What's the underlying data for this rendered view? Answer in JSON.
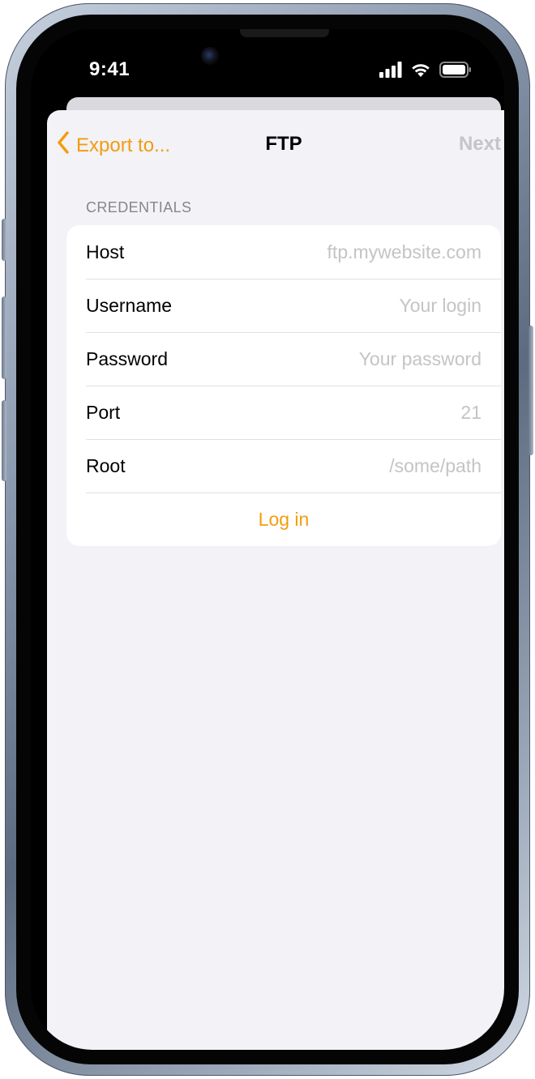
{
  "status_bar": {
    "time": "9:41",
    "icons": [
      "cellular-signal-icon",
      "wifi-icon",
      "battery-icon"
    ]
  },
  "nav": {
    "back_label": "Export to...",
    "title": "FTP",
    "next_label": "Next"
  },
  "credentials": {
    "header": "CREDENTIALS",
    "fields": [
      {
        "label": "Host",
        "value": "",
        "placeholder": "ftp.mywebsite.com"
      },
      {
        "label": "Username",
        "value": "",
        "placeholder": "Your login"
      },
      {
        "label": "Password",
        "value": "",
        "placeholder": "Your password"
      },
      {
        "label": "Port",
        "value": "",
        "placeholder": "21"
      },
      {
        "label": "Root",
        "value": "",
        "placeholder": "/some/path"
      }
    ],
    "login_label": "Log in"
  },
  "colors": {
    "accent": "#f29d0d",
    "disabled": "#c5c5c9",
    "background": "#f2f2f7",
    "placeholder": "#c4c4c8"
  }
}
